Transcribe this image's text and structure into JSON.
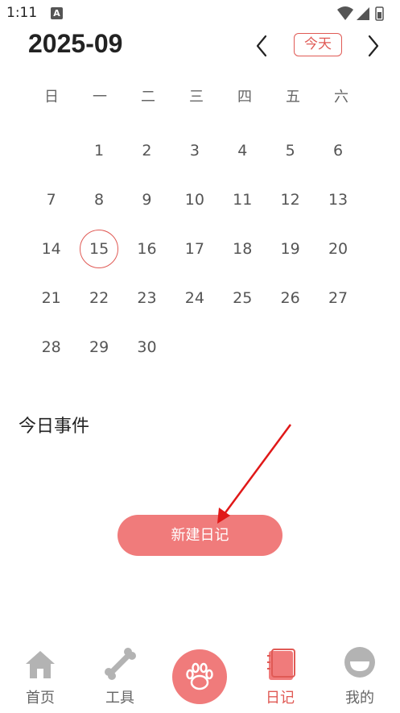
{
  "status_bar": {
    "time": "1:11",
    "notification_letter": "A"
  },
  "header": {
    "month": "2025-09",
    "today_label": "今天"
  },
  "weekdays": [
    "日",
    "一",
    "二",
    "三",
    "四",
    "五",
    "六"
  ],
  "calendar": {
    "leading_blanks": 1,
    "days": [
      "1",
      "2",
      "3",
      "4",
      "5",
      "6",
      "7",
      "8",
      "9",
      "10",
      "11",
      "12",
      "13",
      "14",
      "15",
      "16",
      "17",
      "18",
      "19",
      "20",
      "21",
      "22",
      "23",
      "24",
      "25",
      "26",
      "27",
      "28",
      "29",
      "30"
    ],
    "selected_day": "15"
  },
  "events": {
    "title": "今日事件"
  },
  "actions": {
    "new_diary_label": "新建日记"
  },
  "bottom_nav": {
    "items": [
      {
        "label": "首页",
        "icon": "home-icon"
      },
      {
        "label": "工具",
        "icon": "bone-icon"
      },
      {
        "label": "日记",
        "icon": "notebook-icon"
      },
      {
        "label": "我的",
        "icon": "profile-icon"
      }
    ],
    "center_icon": "paw-icon",
    "active": "日记"
  },
  "colors": {
    "accent": "#e05a55",
    "button": "#f07b7b",
    "inactive_icon": "#b3b3b3"
  }
}
